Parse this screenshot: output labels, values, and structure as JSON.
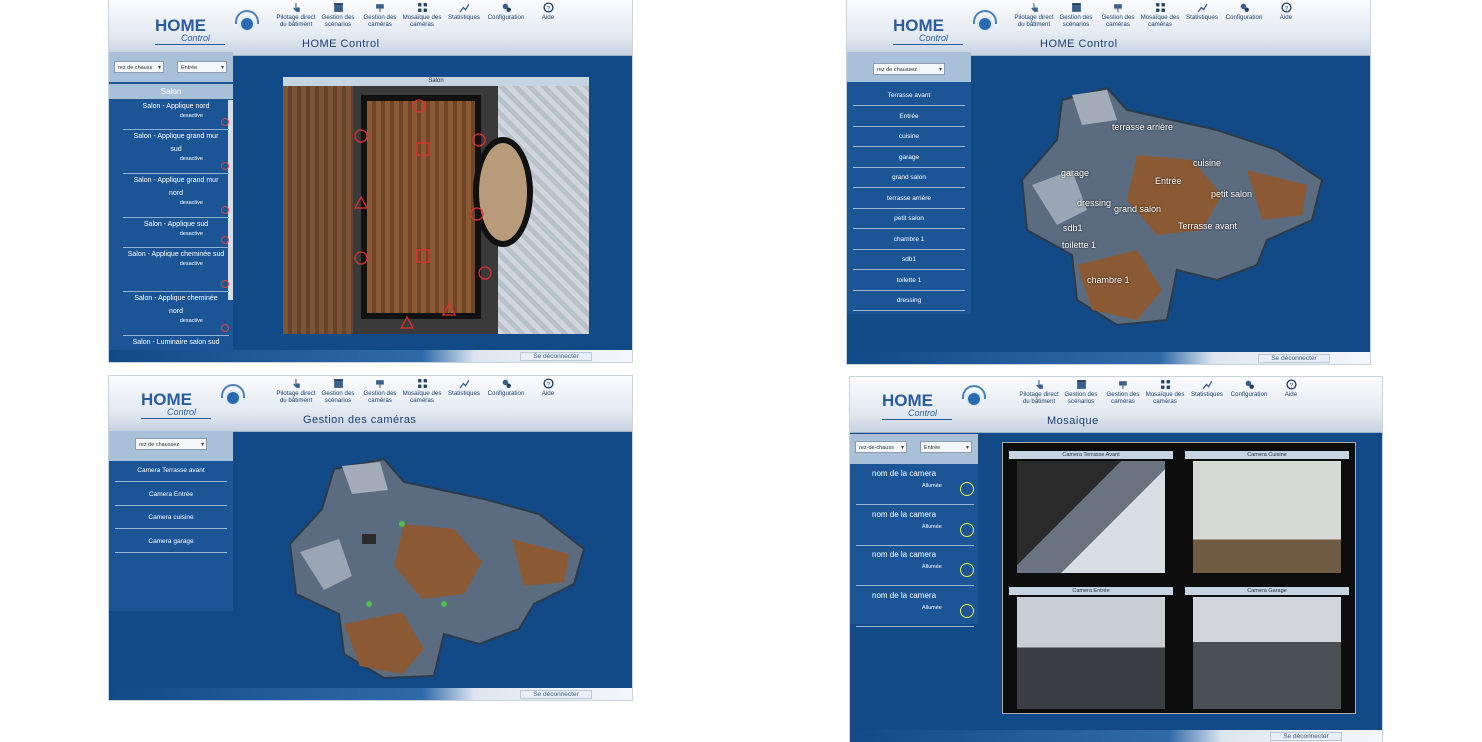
{
  "nav": [
    {
      "label": "Pilotage direct du bâtiment",
      "icon": "hand-pointer-icon"
    },
    {
      "label": "Gestion des scénarios",
      "icon": "clapperboard-icon"
    },
    {
      "label": "Gestion des caméras",
      "icon": "camera-icon"
    },
    {
      "label": "Mosaïque des caméras",
      "icon": "grid-icon"
    },
    {
      "label": "Statistiques",
      "icon": "chart-icon"
    },
    {
      "label": "Configuration",
      "icon": "gears-icon"
    },
    {
      "label": "Aide",
      "icon": "help-icon"
    }
  ],
  "logo": {
    "home": "HOME",
    "control": "Control"
  },
  "logout_label": "Se déconnecter",
  "panel1": {
    "title": "HOME Control",
    "floor_select": "rez de chauss",
    "room_select": "Entrée",
    "section": "Salon",
    "view_title": "Salon",
    "items": [
      {
        "name": "Salon - Applique nord",
        "status": "desactive"
      },
      {
        "name": "Salon - Applique grand mur sud",
        "status": "desactive"
      },
      {
        "name": "Salon - Applique grand mur nord",
        "status": "desactive"
      },
      {
        "name": "Salon - Applique sud",
        "status": "desactive"
      },
      {
        "name": "Salon - Applique cheminée sud",
        "status": "desactive"
      },
      {
        "name": "Salon - Applique cheminée nord",
        "status": "desactive"
      },
      {
        "name": "Salon - Luminaire salon sud",
        "status": ""
      }
    ]
  },
  "panel2": {
    "title": "HOME Control",
    "floor_select": "rez de chaussez",
    "rooms": [
      "Terrasse avant",
      "Entrée",
      "cuisine",
      "garage",
      "grand salon",
      "terrasse arrière",
      "petit salon",
      "chambre 1",
      "sdb1",
      "toilette 1",
      "dressing"
    ],
    "labels": [
      "terrasse arrière",
      "cuisine",
      "garage",
      "Entrée",
      "petit salon",
      "dressing",
      "grand salon",
      "Terrasse avant",
      "sdb1",
      "toilette 1",
      "chambre 1"
    ]
  },
  "panel3": {
    "title": "Gestion des caméras",
    "floor_select": "rez de chaussez",
    "cameras": [
      "Camera Terrasse avant",
      "Camera Entrée",
      "Camera cuisine",
      "Camera garage"
    ]
  },
  "panel4": {
    "title": "Mosaique",
    "floor_select": "rez-de-chauss",
    "room_select": "Entrée",
    "cameras": [
      {
        "name": "nom de la camera",
        "status": "Allumée"
      },
      {
        "name": "nom de la camera",
        "status": "Allumée"
      },
      {
        "name": "nom de la camera",
        "status": "Allumée"
      },
      {
        "name": "nom de la camera",
        "status": "Allumée"
      }
    ],
    "feeds": [
      "Camera Terrasse Avant",
      "Camera Cuisine",
      "Camera Entrée",
      "Camera Garage"
    ]
  }
}
